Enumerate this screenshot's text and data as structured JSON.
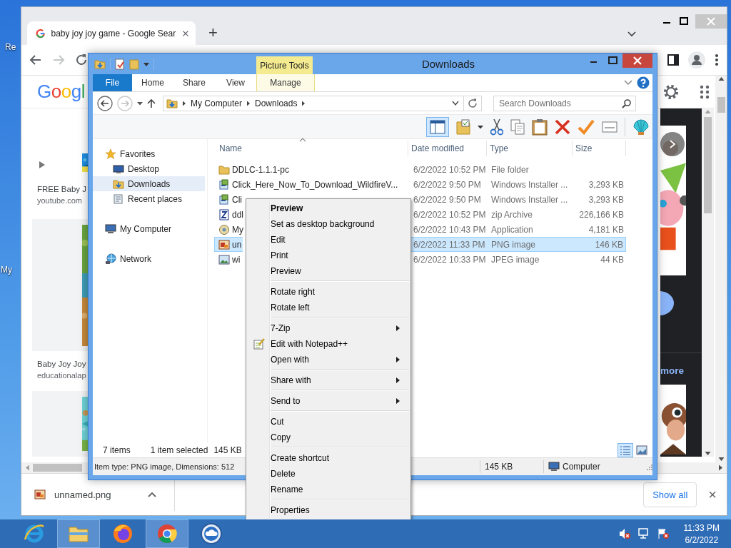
{
  "desktop_icons": [
    {
      "label": "Re"
    },
    {
      "label": "My"
    }
  ],
  "browser": {
    "tab": {
      "title": "baby joy joy game - Google Sear",
      "selected": true
    },
    "new_tab": "+",
    "logo": "Googl",
    "results": [
      {
        "title": "FREE Baby J",
        "source": "youtube.com"
      },
      {
        "title": "Baby Joy Joy",
        "source": "educationalap"
      }
    ],
    "more_link": "more",
    "download": {
      "file": "unnamed.png",
      "show_all": "Show all",
      "close": "×"
    }
  },
  "explorer": {
    "title": "Downloads",
    "context_tab": "Picture Tools",
    "ribbon_tabs": [
      {
        "label": "File",
        "kind": "file"
      },
      {
        "label": "Home",
        "kind": "tab"
      },
      {
        "label": "Share",
        "kind": "tab"
      },
      {
        "label": "View",
        "kind": "tab"
      },
      {
        "label": "Manage",
        "kind": "contextual"
      }
    ],
    "breadcrumbs": [
      "My Computer",
      "Downloads"
    ],
    "search": {
      "placeholder": "Search Downloads"
    },
    "nav": [
      {
        "label": "Favorites",
        "kind": "favorites",
        "selected": false,
        "children": [
          {
            "label": "Desktop",
            "kind": "desktop",
            "selected": false
          },
          {
            "label": "Downloads",
            "kind": "downloads",
            "selected": true
          },
          {
            "label": "Recent places",
            "kind": "recent",
            "selected": false
          }
        ]
      },
      {
        "label": "My Computer",
        "kind": "computer",
        "selected": false
      },
      {
        "label": "Network",
        "kind": "network",
        "selected": false
      }
    ],
    "columns": [
      "Name",
      "Date modified",
      "Type",
      "Size"
    ],
    "files": [
      {
        "name": "DDLC-1.1.1-pc",
        "kind": "folder",
        "date": "6/2/2022 10:52 PM",
        "type": "File folder",
        "selected": false
      },
      {
        "name": "Click_Here_Now_To_Download_WildfireV...",
        "kind": "installer",
        "date": "6/2/2022 9:50 PM",
        "type": "Windows Installer ...",
        "size": "3,293 KB",
        "selected": false
      },
      {
        "name": "Cli",
        "kind": "installer",
        "date": "6/2/2022 9:50 PM",
        "type": "Windows Installer ...",
        "size": "3,293 KB",
        "selected": false
      },
      {
        "name": "ddl",
        "kind": "zip",
        "date": "6/2/2022 10:52 PM",
        "type": "zip Archive",
        "size": "226,166 KB",
        "selected": false
      },
      {
        "name": "My",
        "kind": "application",
        "date": "6/2/2022 10:43 PM",
        "type": "Application",
        "size": "4,181 KB",
        "selected": false
      },
      {
        "name": "un",
        "kind": "png",
        "date": "6/2/2022 11:33 PM",
        "type": "PNG image",
        "size": "146 KB",
        "selected": true
      },
      {
        "name": "wi",
        "kind": "jpeg",
        "date": "6/2/2022 10:33 PM",
        "type": "JPEG image",
        "size": "44 KB",
        "selected": false
      }
    ],
    "status": {
      "count": "7 items",
      "selection": "1 item selected",
      "selection_size": "145 KB"
    },
    "details": {
      "info": "Item type: PNG image, Dimensions: 512",
      "size": "145 KB",
      "location": "Computer"
    }
  },
  "context_menu": {
    "groups": [
      [
        {
          "label": "Preview",
          "default": true,
          "submenu": false,
          "kind": "plain"
        },
        {
          "label": "Set as desktop background",
          "default": false,
          "submenu": false,
          "kind": "plain"
        },
        {
          "label": "Edit",
          "default": false,
          "submenu": false,
          "kind": "plain"
        },
        {
          "label": "Print",
          "default": false,
          "submenu": false,
          "kind": "plain"
        },
        {
          "label": "Preview",
          "default": false,
          "submenu": false,
          "kind": "plain"
        }
      ],
      [
        {
          "label": "Rotate right",
          "default": false,
          "submenu": false,
          "kind": "plain"
        },
        {
          "label": "Rotate left",
          "default": false,
          "submenu": false,
          "kind": "plain"
        }
      ],
      [
        {
          "label": "7-Zip",
          "default": false,
          "submenu": true,
          "kind": "plain"
        },
        {
          "label": "Edit with Notepad++",
          "default": false,
          "submenu": false,
          "kind": "notepad"
        },
        {
          "label": "Open with",
          "default": false,
          "submenu": true,
          "kind": "plain"
        }
      ],
      [
        {
          "label": "Share with",
          "default": false,
          "submenu": true,
          "kind": "plain"
        }
      ],
      [
        {
          "label": "Send to",
          "default": false,
          "submenu": true,
          "kind": "plain"
        }
      ],
      [
        {
          "label": "Cut",
          "default": false,
          "submenu": false,
          "kind": "plain"
        },
        {
          "label": "Copy",
          "default": false,
          "submenu": false,
          "kind": "plain"
        }
      ],
      [
        {
          "label": "Create shortcut",
          "default": false,
          "submenu": false,
          "kind": "plain"
        },
        {
          "label": "Delete",
          "default": false,
          "submenu": false,
          "kind": "plain"
        },
        {
          "label": "Rename",
          "default": false,
          "submenu": false,
          "kind": "plain"
        }
      ],
      [
        {
          "label": "Properties",
          "default": false,
          "submenu": false,
          "kind": "plain"
        }
      ]
    ]
  },
  "taskbar": {
    "apps": [
      {
        "kind": "ie",
        "active": false
      },
      {
        "kind": "explorer",
        "active": true
      },
      {
        "kind": "firefox",
        "active": false
      },
      {
        "kind": "chrome",
        "active": true
      },
      {
        "kind": "cloud",
        "active": false
      }
    ],
    "tray": [
      {
        "kind": "volume_muted"
      },
      {
        "kind": "network"
      },
      {
        "kind": "flag"
      }
    ],
    "time": "11:33 PM",
    "date": "6/2/2022"
  }
}
